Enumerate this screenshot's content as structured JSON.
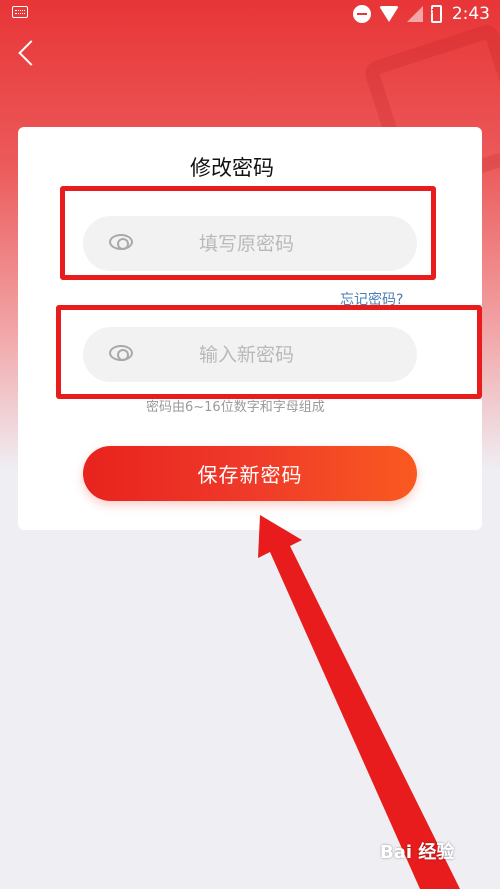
{
  "status_bar": {
    "time": "2:43"
  },
  "title": "修改密码",
  "fields": {
    "old_password": {
      "placeholder": "填写原密码",
      "value": ""
    },
    "new_password": {
      "placeholder": "输入新密码",
      "value": ""
    }
  },
  "forgot_link": "忘记密码?",
  "hint": "密码由6~16位数字和字母组成",
  "save_button": "保存新密码",
  "watermark": "Bai 经验",
  "colors": {
    "header_red": "#e83537",
    "button_start": "#e8231d",
    "button_end": "#f95a20",
    "annotation_red": "#e81c1c",
    "link_blue": "#4a7fb5"
  }
}
